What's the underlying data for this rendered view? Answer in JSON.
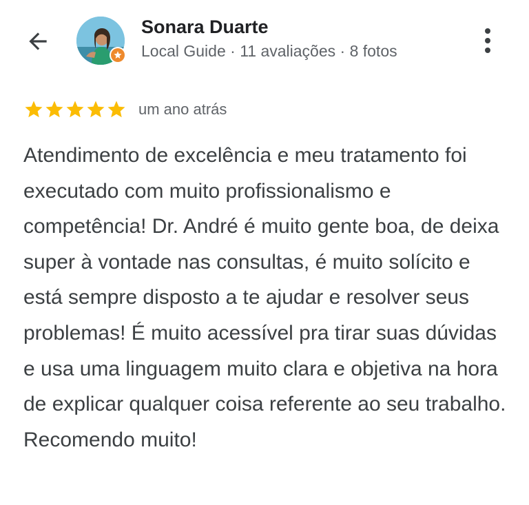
{
  "reviewer": {
    "name": "Sonara Duarte",
    "meta": "Local Guide · 11 avaliações · 8 fotos",
    "badge_color": "#ee8a2d"
  },
  "icons": {
    "back": "arrow-back-icon",
    "more": "more-vert-icon",
    "star": "star-icon",
    "guide_badge": "local-guide-badge-icon"
  },
  "rating": {
    "stars": 5,
    "max": 5,
    "star_color": "#fbbc04",
    "time": "um ano atrás"
  },
  "review": {
    "text": "Atendimento de excelência e meu tratamento foi executado com muito profissionalismo e competência! Dr. André é muito gente boa, de deixa super à vontade nas consultas, é muito solícito e está sempre disposto a te ajudar e resolver seus problemas! É muito acessível pra tirar suas dúvidas e usa uma linguagem muito clara e objetiva na hora de explicar qualquer coisa referente ao seu trabalho. Recomendo muito!"
  }
}
